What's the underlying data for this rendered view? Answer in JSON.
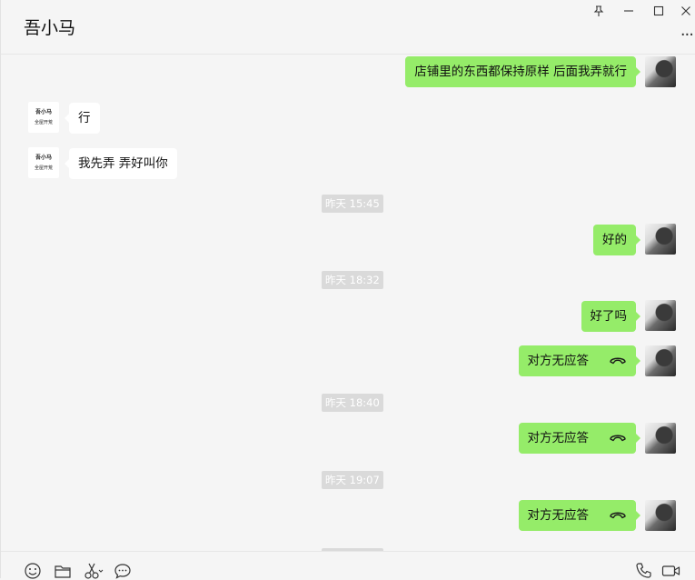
{
  "header": {
    "title": "吾小马"
  },
  "window": {
    "pin_icon": "pin-icon",
    "min_icon": "minimize-icon",
    "max_icon": "maximize-icon",
    "close_icon": "close-icon",
    "more_icon": "more-icon"
  },
  "messages": [
    {
      "from": "me",
      "text": "店铺里的东西都保持原样  后面我弄就行"
    },
    {
      "from": "other",
      "text": "行"
    },
    {
      "from": "other",
      "text": "我先弄  弄好叫你"
    },
    {
      "type": "time",
      "text": "昨天 15:45"
    },
    {
      "from": "me",
      "text": "好的"
    },
    {
      "type": "time",
      "text": "昨天 18:32"
    },
    {
      "from": "me",
      "text": "好了吗"
    },
    {
      "from": "me",
      "text": "对方无应答",
      "call": true
    },
    {
      "type": "time",
      "text": "昨天 18:40"
    },
    {
      "from": "me",
      "text": "对方无应答",
      "call": true
    },
    {
      "type": "time",
      "text": "昨天 19:07"
    },
    {
      "from": "me",
      "text": "对方无应答",
      "call": true
    }
  ],
  "avatar_other": {
    "line1": "吾小马",
    "line2": "全屋开荒"
  },
  "colors": {
    "me_bubble": "#95ec69",
    "other_bubble": "#ffffff",
    "background": "#f5f5f5",
    "time_badge": "#dadada"
  },
  "footer": {
    "icons": [
      "emoji-icon",
      "folder-icon",
      "scissors-icon",
      "chat-history-icon",
      "phone-icon",
      "video-icon"
    ]
  }
}
